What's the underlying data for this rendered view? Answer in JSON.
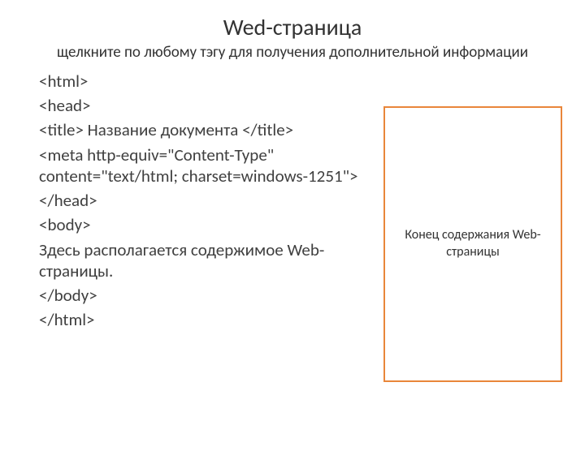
{
  "header": {
    "title": "Wed-страница",
    "subtitle": "щелкните по любому тэгу для получения дополнительной информации"
  },
  "code": {
    "l1": "<html>",
    "l2": "<head>",
    "l3": "<title> Название документа </title>",
    "l4": "<meta http-equiv=\"Content-Type\" content=\"text/html; charset=windows-1251\">",
    "l5": "</head>",
    "l6": "<body>",
    "l7": "   Здесь располагается содержимое Web-страницы.",
    "l8": "</body>",
    "l9": "</html>"
  },
  "preview": {
    "text": "Конец содержания Web-страницы"
  }
}
